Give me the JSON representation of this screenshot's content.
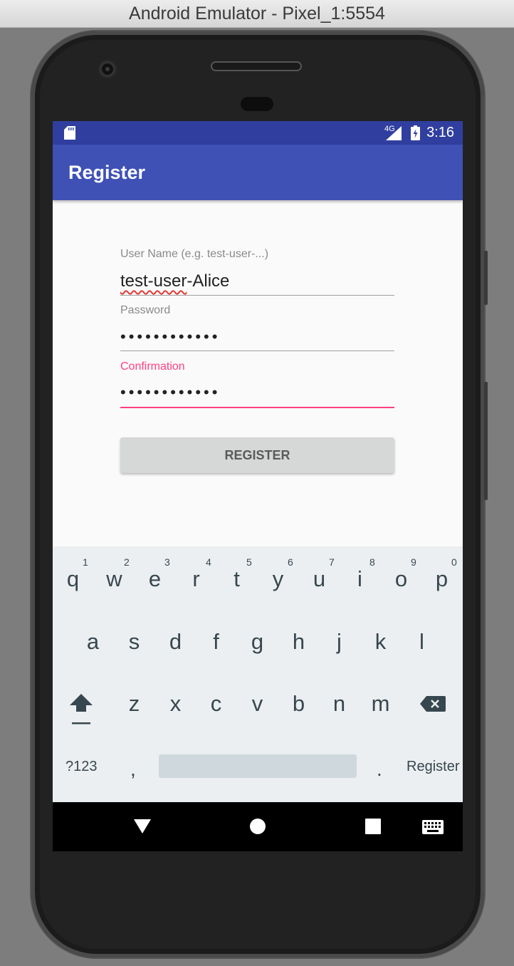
{
  "window": {
    "title": "Android Emulator - Pixel_1:5554"
  },
  "status_bar": {
    "network": "4G",
    "time": "3:16",
    "icons": [
      "sd-card-icon",
      "signal-icon",
      "battery-charging-icon"
    ]
  },
  "app_bar": {
    "title": "Register"
  },
  "form": {
    "username": {
      "label": "User Name (e.g. test-user-...)",
      "value_misspelled": "test-user",
      "value_rest": "-Alice"
    },
    "password": {
      "label": "Password",
      "value": "••••••••••••"
    },
    "confirmation": {
      "label": "Confirmation",
      "value": "••••••••••••"
    },
    "register_button": "REGISTER"
  },
  "colors": {
    "status_bar": "#303f9f",
    "app_bar": "#3f51b5",
    "accent": "#ff4081",
    "keyboard_bg": "#eceff1"
  },
  "keyboard": {
    "row1": [
      "q",
      "w",
      "e",
      "r",
      "t",
      "y",
      "u",
      "i",
      "o",
      "p"
    ],
    "row1_hints": [
      "1",
      "2",
      "3",
      "4",
      "5",
      "6",
      "7",
      "8",
      "9",
      "0"
    ],
    "row2": [
      "a",
      "s",
      "d",
      "f",
      "g",
      "h",
      "j",
      "k",
      "l"
    ],
    "row3": [
      "z",
      "x",
      "c",
      "v",
      "b",
      "n",
      "m"
    ],
    "symbols": "?123",
    "comma": ",",
    "period": ".",
    "action": "Register"
  },
  "nav_bar": {
    "icons": [
      "back-icon",
      "home-icon",
      "recents-icon",
      "keyboard-icon"
    ]
  }
}
